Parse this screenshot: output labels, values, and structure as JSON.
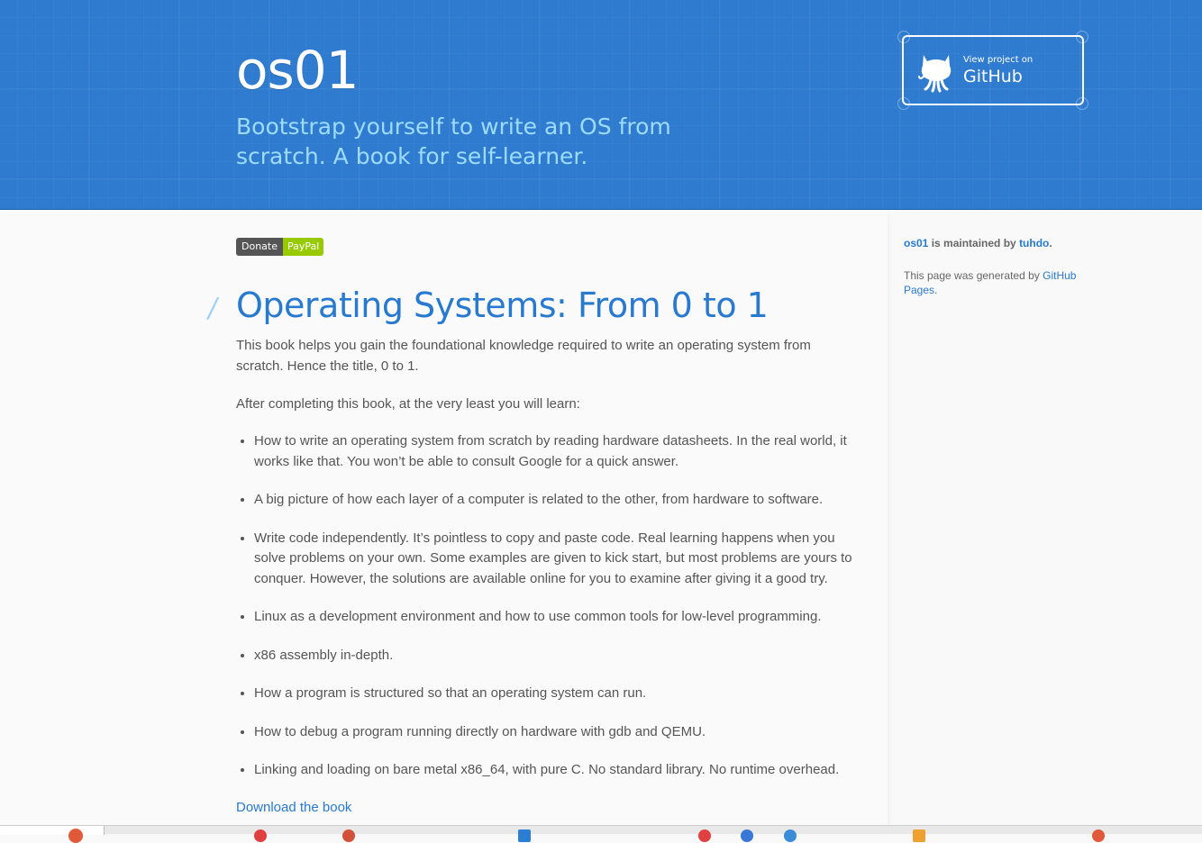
{
  "header": {
    "title": "os01",
    "tagline": "Bootstrap yourself to write an OS from scratch. A book for self-learner.",
    "github_button": {
      "small_label": "View project on",
      "big_label": "GitHub",
      "icon": "octocat-icon"
    }
  },
  "donate": {
    "left": "Donate",
    "right": "PayPal"
  },
  "main": {
    "heading": "Operating Systems: From 0 to 1",
    "intro": "This book helps you gain the foundational knowledge required to write an operating system from scratch. Hence the title, 0 to 1.",
    "after": "After completing this book, at the very least you will learn:",
    "items": [
      "How to write an operating system from scratch by reading hardware datasheets. In the real world, it works like that. You won’t be able to consult Google for a quick answer.",
      "A big picture of how each layer of a computer is related to the other, from hardware to software.",
      "Write code independently. It’s pointless to copy and paste code. Real learning happens when you solve problems on your own. Some examples are given to kick start, but most problems are yours to conquer. However, the solutions are available online for you to examine after giving it a good try.",
      "Linux as a development environment and how to use common tools for low-level programming.",
      "x86 assembly in-depth.",
      "How a program is structured so that an operating system can run.",
      "How to debug a program running directly on hardware with gdb and QEMU.",
      "Linking and loading on bare metal x86_64, with pure C. No standard library. No runtime overhead."
    ],
    "download": "Download the book"
  },
  "sidebar": {
    "project": "os01",
    "maintained_by": " is maintained by ",
    "maintainer": "tuhdo",
    "period": ".",
    "generated_prefix": "This page was generated by ",
    "generated_link": "GitHub Pages",
    "generated_suffix": "."
  },
  "colors": {
    "header_bg": "#2e7bcf",
    "tagline": "#9ddcff",
    "link": "#2879d0",
    "paypal": "#97ca00"
  }
}
